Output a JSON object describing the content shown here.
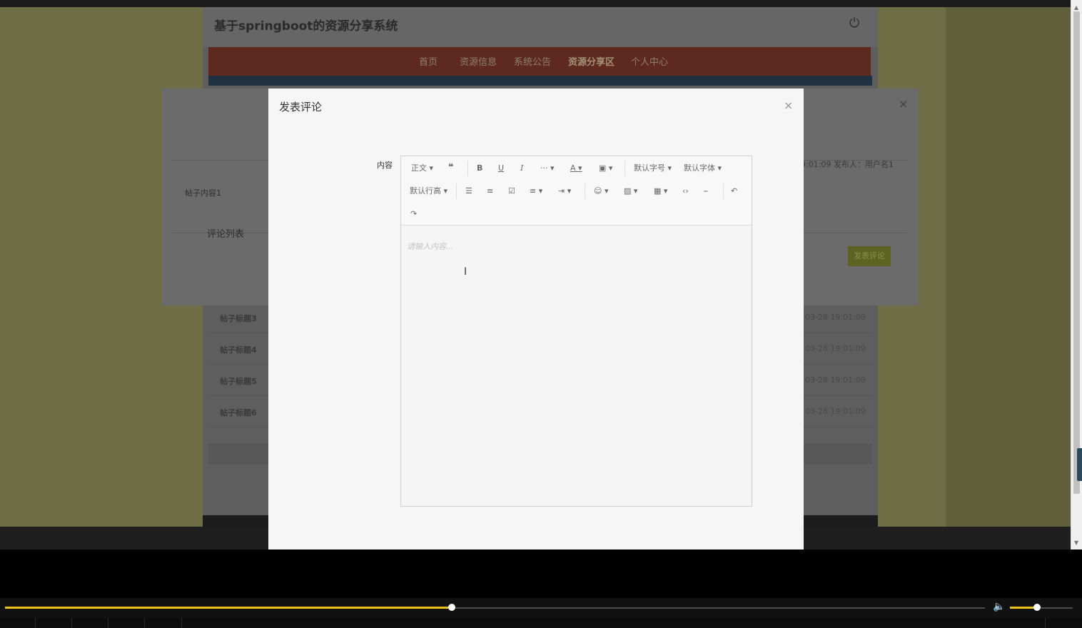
{
  "site": {
    "title": "基于springboot的资源分享系统"
  },
  "nav": {
    "items": [
      "首页",
      "资源信息",
      "系统公告",
      "资源分享区",
      "个人中心"
    ]
  },
  "post": {
    "content": "帖子内容1",
    "meta": "9:01:09   发布人：用户名1",
    "comment_list_label": "评论列表",
    "post_comment_label": "发表评论"
  },
  "rows": [
    {
      "title": "帖子标题3",
      "date": "03-28 19:01:09"
    },
    {
      "title": "帖子标题4",
      "date": "03-28 19:01:09"
    },
    {
      "title": "帖子标题5",
      "date": "03-28 19:01:09"
    },
    {
      "title": "帖子标题6",
      "date": "03-28 19:01:09"
    }
  ],
  "modal": {
    "title": "发表评论",
    "close": "×",
    "content_label": "内容",
    "placeholder": "请输入内容..."
  },
  "toolbar": {
    "paragraph": "正文",
    "font_size": "默认字号",
    "font_family": "默认字体",
    "line_height": "默认行高"
  },
  "player": {
    "progress": 0.456,
    "volume": 0.43
  },
  "colors": {
    "accent": "#e8c21a",
    "nav": "#5e2a20",
    "button": "#5b6222"
  }
}
